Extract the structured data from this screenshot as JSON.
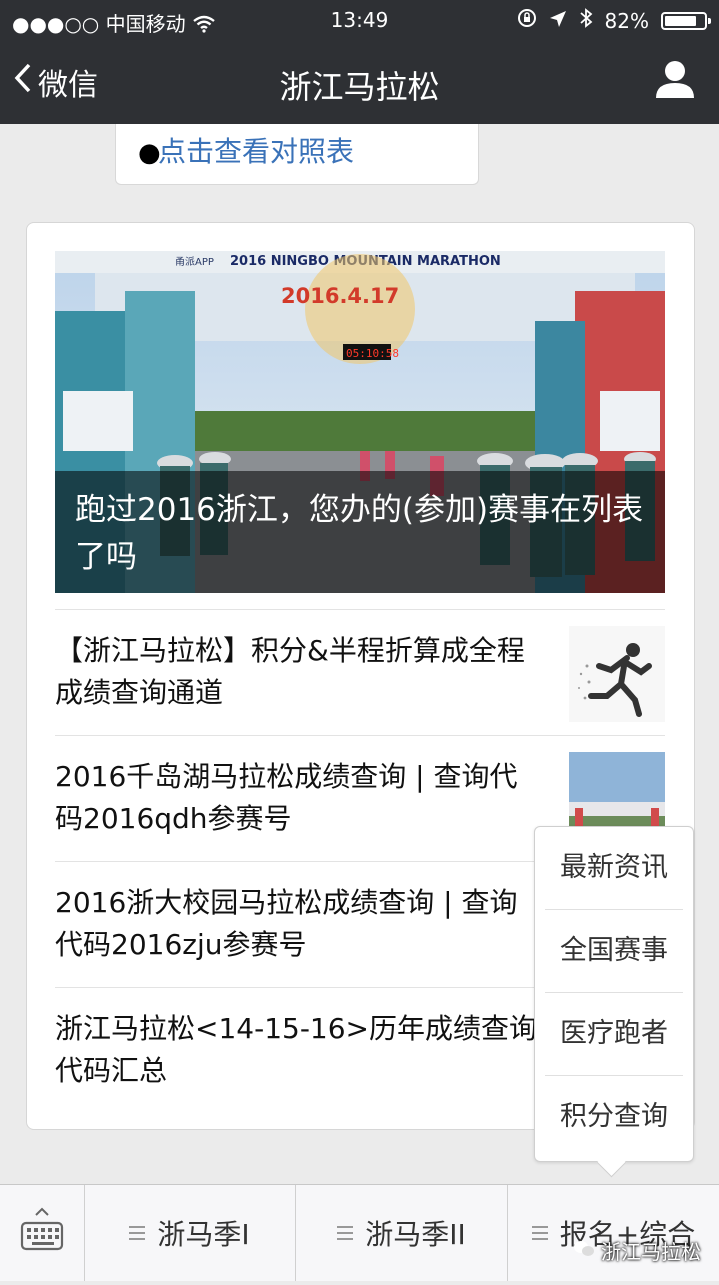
{
  "status": {
    "carrier": "中国移动",
    "time": "13:49",
    "battery": "82%",
    "battery_level": 0.82
  },
  "nav": {
    "back_label": "微信",
    "title": "浙江马拉松"
  },
  "top_card": {
    "link": "点击查看对照表"
  },
  "hero": {
    "banner_text": "2016 NINGBO MOUNTAIN MARATHON",
    "banner_brand": "甬派APP",
    "date_text": "2016.4.17",
    "clock": "05:10:58",
    "caption": "跑过2016浙江，您办的(参加)赛事在列表了吗"
  },
  "articles": [
    {
      "title": "【浙江马拉松】积分&半程折算成全程成绩查询通道",
      "thumb_icon": "runner-silhouette-icon"
    },
    {
      "title": "2016千岛湖马拉松成绩查询 | 查询代码2016qdh参赛号",
      "thumb_icon": "marathon-arch-photo"
    },
    {
      "title": "2016浙大校园马拉松成绩查询 | 查询代码2016zju参赛号"
    },
    {
      "title": "浙江马拉松<14-15-16>历年成绩查询代码汇总"
    }
  ],
  "popup_menu": {
    "items": [
      "最新资讯",
      "全国赛事",
      "医疗跑者",
      "积分查询"
    ]
  },
  "bottom_menu": {
    "tabs": [
      "浙马季I",
      "浙马季II",
      "报名+综合"
    ]
  },
  "watermark": "浙江马拉松"
}
